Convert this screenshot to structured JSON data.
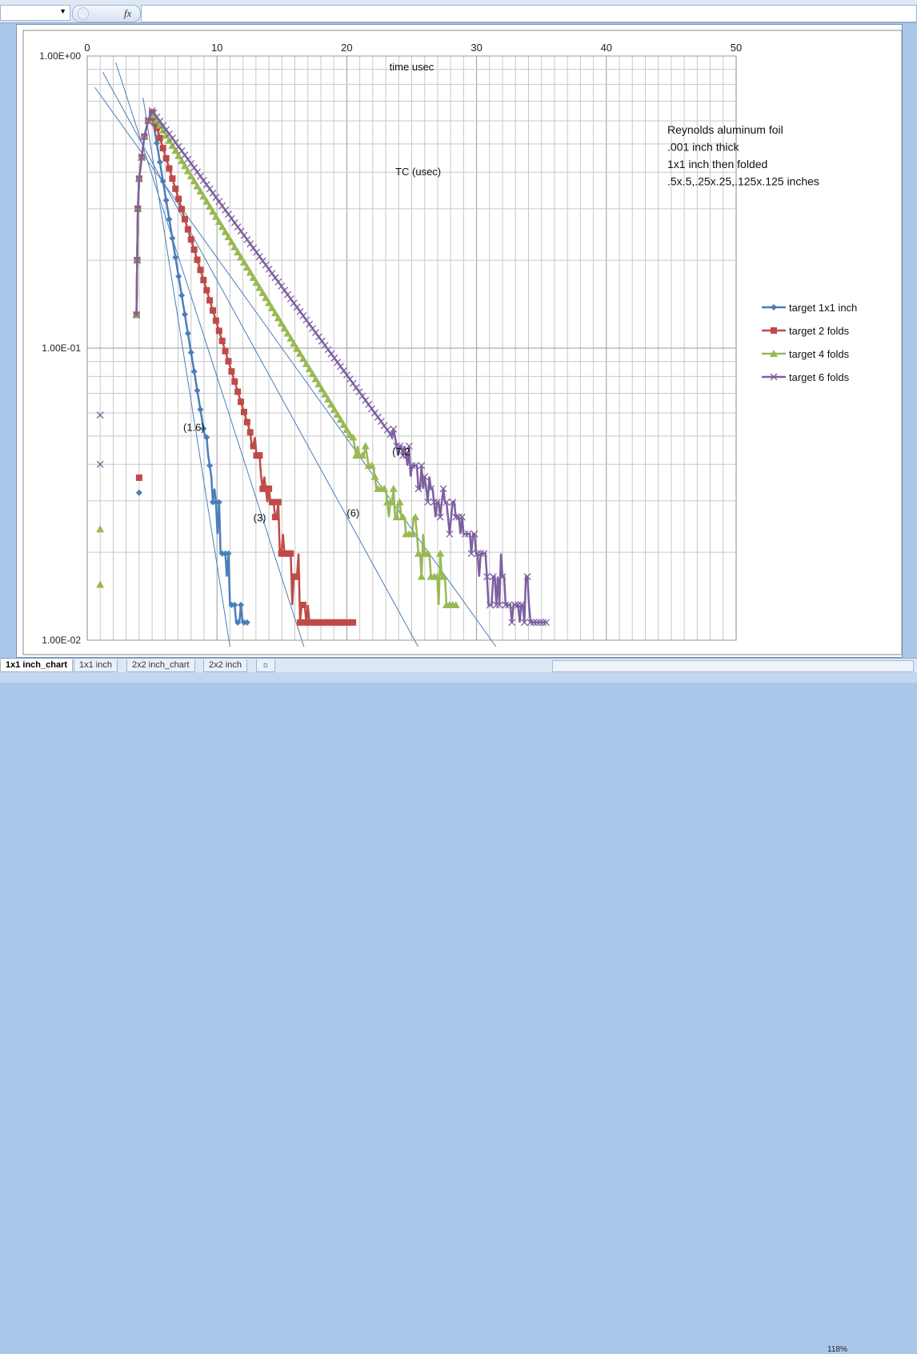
{
  "formula_bar": {
    "fx_label": "fx"
  },
  "sheet_tabs": [
    "1x1 inch_chart",
    "1x1 inch",
    "2x2 inch_chart",
    "2x2 inch"
  ],
  "zoom_level": "118%",
  "chart_data": {
    "type": "scatter",
    "title": "TC (usec)",
    "xlabel": "time usec",
    "ylabel": "",
    "xlim": [
      0,
      50
    ],
    "ylim": [
      0.01,
      1
    ],
    "yscale": "log",
    "x_ticks": [
      "0",
      "10",
      "20",
      "30",
      "40",
      "50"
    ],
    "y_ticks": [
      "1.00E+00",
      "1.00E-01",
      "1.00E-02"
    ],
    "grid": true,
    "legend_position": "right",
    "annotation": [
      "Reynolds aluminum foil",
      ".001 inch thick",
      "1x1 inch then folded",
      ".5x.5,.25x.25,.125x.125 inches"
    ],
    "fit_labels": [
      {
        "text": "(1.6)",
        "x": 7.4,
        "y": 0.052
      },
      {
        "text": "(3)",
        "x": 12.8,
        "y": 0.0255
      },
      {
        "text": "(6)",
        "x": 20.0,
        "y": 0.0265
      },
      {
        "text": "(7.2",
        "x": 23.5,
        "y": 0.043
      }
    ],
    "series": [
      {
        "name": "target 1x1 inch",
        "color": "#4a7ebb",
        "marker": "diamond",
        "tau": 1.6,
        "peak_x": 5.0,
        "peak_y": 0.63,
        "floor": 0.0115,
        "end_x": 12.5,
        "outliers": [
          [
            4.0,
            0.032
          ]
        ]
      },
      {
        "name": "target 2 folds",
        "color": "#be4b48",
        "marker": "square",
        "tau": 3.0,
        "peak_x": 5.0,
        "peak_y": 0.64,
        "floor": 0.0115,
        "end_x": 20.5,
        "outliers": [
          [
            4.0,
            0.036
          ]
        ]
      },
      {
        "name": "target 4 folds",
        "color": "#98b954",
        "marker": "triangle",
        "tau": 6.0,
        "peak_x": 5.0,
        "peak_y": 0.64,
        "floor": 0.0115,
        "end_x": 28.5,
        "outliers": [
          [
            1.0,
            0.024
          ],
          [
            1.0,
            0.0155
          ]
        ]
      },
      {
        "name": "target 6 folds",
        "color": "#7d60a0",
        "marker": "x",
        "tau": 7.2,
        "peak_x": 5.0,
        "peak_y": 0.65,
        "floor": 0.0115,
        "end_x": 35.5,
        "outliers": [
          [
            1.0,
            0.059
          ],
          [
            1.0,
            0.04
          ]
        ]
      }
    ],
    "fit_lines": [
      {
        "tau": 1.6,
        "x0": 4.3,
        "y0": 0.72,
        "x1": 11.0,
        "y1": 0.0095
      },
      {
        "tau": 3.0,
        "x0": 2.2,
        "y0": 0.95,
        "x1": 16.7,
        "y1": 0.0095
      },
      {
        "tau": 6.0,
        "x0": 1.2,
        "y0": 0.88,
        "x1": 25.5,
        "y1": 0.0095
      },
      {
        "tau": 7.2,
        "x0": 0.6,
        "y0": 0.78,
        "x1": 31.5,
        "y1": 0.0095
      }
    ]
  }
}
